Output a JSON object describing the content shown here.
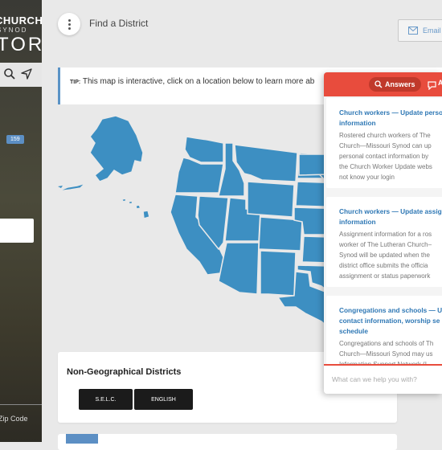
{
  "sidebar": {
    "brand_line1": "CHURCH",
    "brand_line2": "SYNOD",
    "brand_line3": "TOR",
    "count_badge": "159",
    "zip_label": "Zip Code",
    "icons": [
      "search-icon",
      "location-arrow-icon"
    ]
  },
  "topbar": {
    "title": "Find a District",
    "email_label": "Email"
  },
  "tip": {
    "label": "TIP:",
    "text": "This map is interactive, click on a location below to learn more ab"
  },
  "nongeo": {
    "title": "Non-Geographical Districts",
    "buttons": [
      "S.E.L.C.",
      "ENGLISH"
    ]
  },
  "help": {
    "tab_answers": "Answers",
    "tab_ask": "A",
    "accent": "#e84c3d",
    "cards": [
      {
        "title_lines": [
          "Church workers — Update perso",
          "information"
        ],
        "body_lines": [
          "Rostered church workers of The",
          "Church—Missouri Synod can up",
          "personal contact information by",
          "the Church Worker Update webs",
          "not know your login"
        ]
      },
      {
        "title_lines": [
          "Church workers — Update assig",
          "information"
        ],
        "body_lines": [
          "Assignment information for a ros",
          "worker of The Lutheran Church–",
          "Synod will be updated when the",
          "district office submits the officia",
          "assignment or status paperwork"
        ]
      },
      {
        "title_lines": [
          "Congregations and schools — U",
          "contact information, worship se",
          "schedule"
        ],
        "body_lines": [
          "Congregations and schools of Th",
          "Church—Missouri Synod may us",
          "Information Support Network (I"
        ]
      }
    ],
    "input_placeholder": "What can we help you with?"
  },
  "colors": {
    "map_fill": "#3d8fc2",
    "tip_border": "#5a93c6",
    "link_blue": "#2f78b5"
  }
}
